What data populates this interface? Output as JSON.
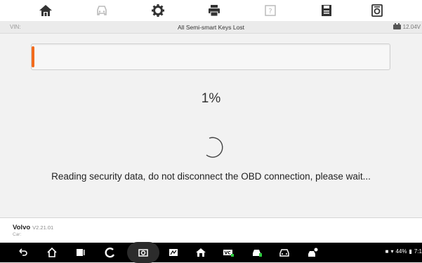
{
  "toolbar": {
    "icons": [
      "home-icon",
      "car-icon",
      "gear-icon",
      "printer-icon",
      "help-icon",
      "save-icon",
      "report-icon"
    ]
  },
  "infobar": {
    "vin_label": "VIN:",
    "title": "All Semi-smart Keys Lost",
    "voltage": "12.04V"
  },
  "main": {
    "progress_percent": 1,
    "percent_text": "1%",
    "message": "Reading security data, do not disconnect the OBD connection, please wait..."
  },
  "footer": {
    "brand": "Volvo",
    "version": "V2.21.01",
    "car_label": "Car:"
  },
  "navbar": {
    "status_text": "44%",
    "time_text": "7:1"
  },
  "colors": {
    "accent": "#f26b1d",
    "toolbar_icon": "#333333",
    "toolbar_icon_disabled": "#bbbbbb"
  }
}
